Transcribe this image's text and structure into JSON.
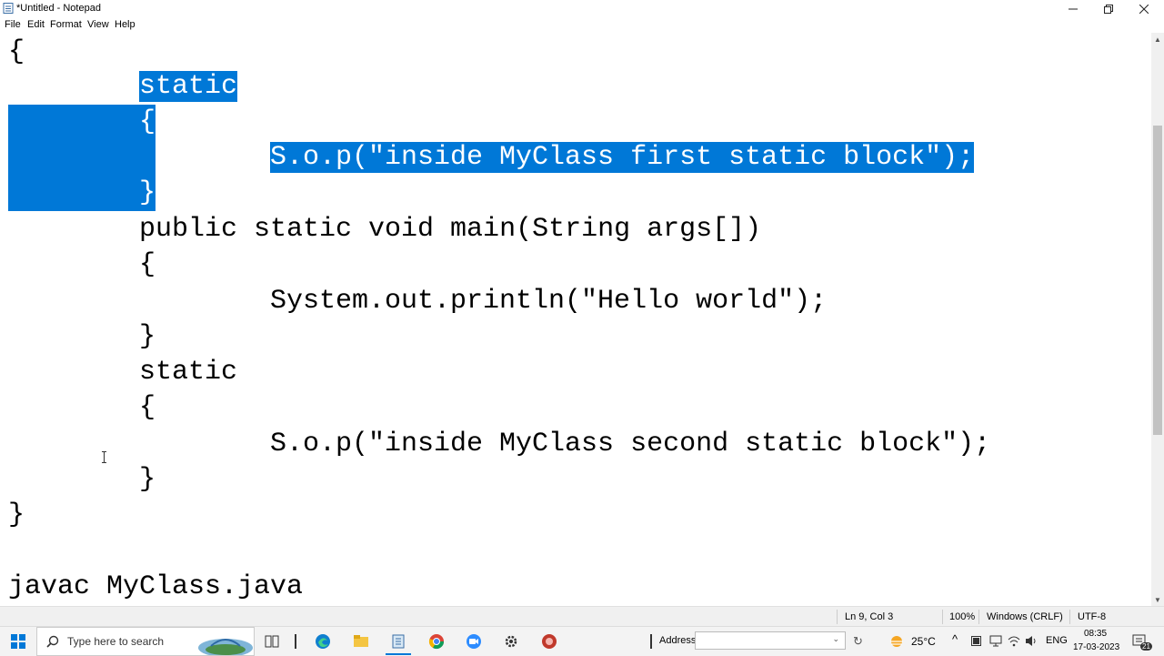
{
  "window": {
    "title": "*Untitled - Notepad",
    "minimize_icon": "minimize-icon",
    "maximize_icon": "restore-icon",
    "close_icon": "close-icon"
  },
  "menu": {
    "file": "File",
    "edit": "Edit",
    "format": "Format",
    "view": "View",
    "help": "Help"
  },
  "editor": {
    "lines": [
      "{",
      "\tstatic",
      "\t{",
      "\t\tS.o.p(\"inside MyClass first static block\");",
      "\t}",
      "\tpublic static void main(String args[])",
      "\t{",
      "\t\tSystem.out.println(\"Hello world\");",
      "\t}",
      "\tstatic",
      "\t{",
      "\t\tS.o.p(\"inside MyClass second static block\");",
      "\t}",
      "}",
      "",
      "javac MyClass.java"
    ],
    "line_texts": {
      "l0": "{",
      "l1": "static",
      "l2": "{",
      "l3": "S.o.p(\"inside MyClass first static block\");",
      "l4": "}",
      "l5": "public static void main(String args[])",
      "l6": "{",
      "l7": "System.out.println(\"Hello world\");",
      "l8": "}",
      "l9": "static",
      "l10": "{",
      "l11": "S.o.p(\"inside MyClass second static block\");",
      "l12": "}",
      "l13": "}",
      "l15": "javac MyClass.java"
    },
    "selection_color": "#0078d7"
  },
  "status": {
    "position": "Ln 9, Col 3",
    "zoom": "100%",
    "line_ending": "Windows (CRLF)",
    "encoding": "UTF-8"
  },
  "taskbar": {
    "search_placeholder": "Type here to search",
    "address_label": "Address",
    "weather": "25°C",
    "language": "ENG",
    "time": "08:35",
    "date": "17-03-2023",
    "notification_count": "21"
  }
}
